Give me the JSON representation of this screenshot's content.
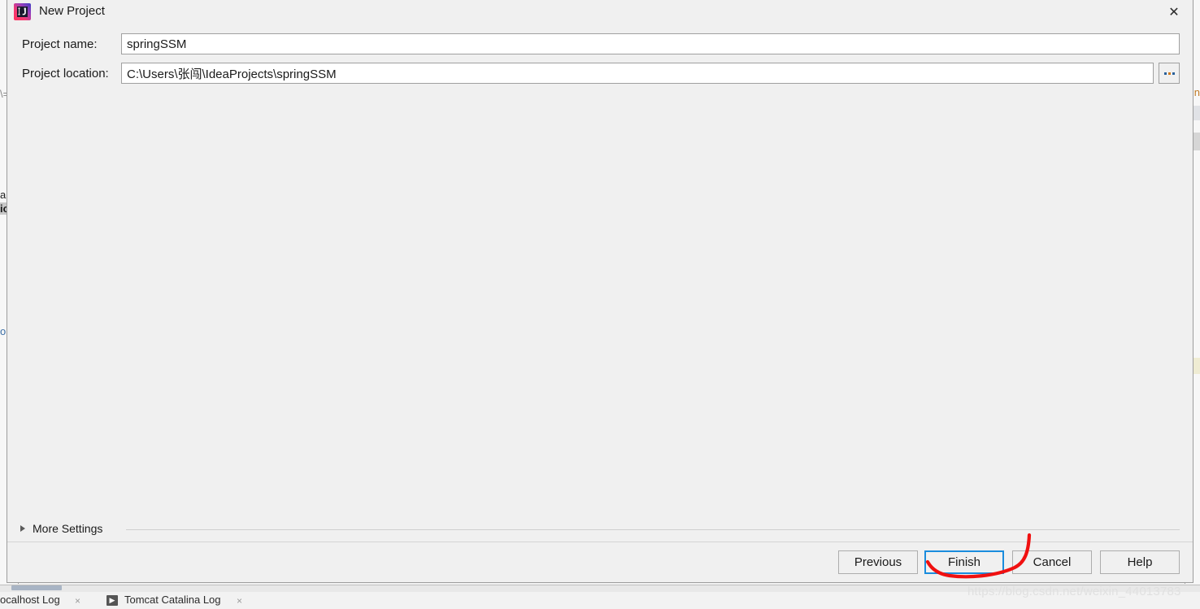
{
  "background": {
    "left_fragments": [
      "\\=",
      "a",
      "ic",
      "ol"
    ],
    "right_fragment": "rin",
    "tabs": [
      {
        "label": "ocalhost Log",
        "close": "×"
      },
      {
        "label": "Tomcat Catalina Log",
        "close": "×"
      }
    ],
    "run_icon": "▶"
  },
  "dialog": {
    "title": "New Project",
    "app_icon": "intellij-idea-icon",
    "close_icon": "✕",
    "fields": [
      {
        "label": "Project name:",
        "value": "springSSM",
        "placeholder": "",
        "name": "project-name"
      },
      {
        "label": "Project location:",
        "value": "C:\\Users\\张闯\\IdeaProjects\\springSSM",
        "placeholder": "",
        "name": "project-location"
      }
    ],
    "browse_button": {
      "label": "...",
      "dots": [
        "#2a6099",
        "#d07a1b",
        "#2a6099"
      ]
    },
    "more_settings": {
      "label": "More Settings",
      "expanded": false,
      "triangle": "▶"
    },
    "buttons": [
      {
        "label": "Previous",
        "name": "previous-button",
        "default": false
      },
      {
        "label": "Finish",
        "name": "finish-button",
        "default": true
      },
      {
        "label": "Cancel",
        "name": "cancel-button",
        "default": false
      },
      {
        "label": "Help",
        "name": "help-button",
        "default": false
      }
    ]
  },
  "annotation": {
    "color": "#f01010",
    "shape": "hand-drawn-check-around-finish"
  },
  "watermark": {
    "text": "https://blog.csdn.net/weixin_44013783"
  },
  "colors": {
    "dialog_bg": "#f0f0f0",
    "field_bg": "#ffffff",
    "field_border": "#a0a0a0",
    "default_button_border": "#1a8cdd",
    "text": "#1a1a1a",
    "annotation_red": "#f01010"
  }
}
